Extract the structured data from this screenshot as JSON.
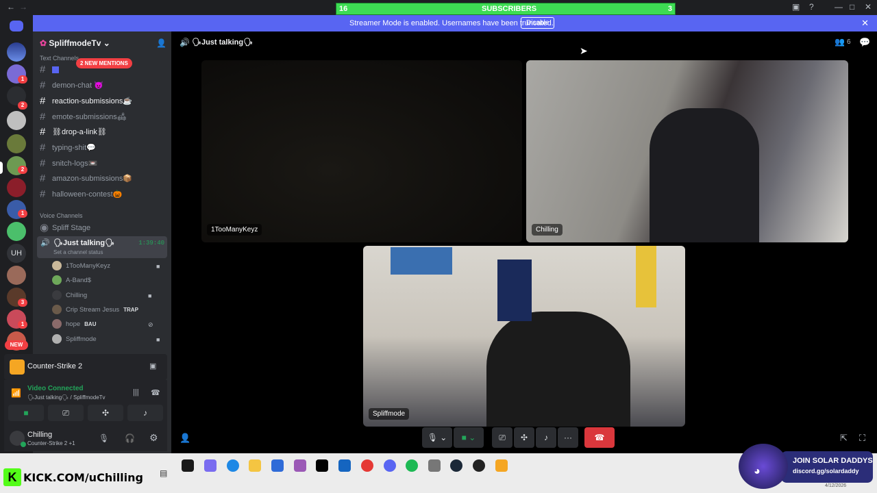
{
  "subscribers": {
    "left_count": "16",
    "label": "SUBSCRIBERS",
    "right_count": "3"
  },
  "banner": {
    "message": "Streamer Mode is enabled. Usernames have been truncated.",
    "disable": "Disable"
  },
  "server": {
    "name": "SpliffmodeTv"
  },
  "mentions": "2 NEW MENTIONS",
  "rail": {
    "uh": "UH",
    "new": "NEW",
    "badges": [
      "1",
      "2",
      "2",
      "1",
      "1",
      "3",
      "1"
    ]
  },
  "categories": {
    "text": "Text Channels",
    "voice": "Voice Channels"
  },
  "text_channels": [
    "demon-chat 😈",
    "reaction-submissions☕",
    "emote-submissions🛋",
    "⛓drop-a-link⛓",
    "typing-shit💬",
    "snitch-logs📼",
    "amazon-submissions📦",
    "halloween-contest🎃"
  ],
  "voice_channels": {
    "stage": "Spliff Stage",
    "active": "🗣Just talking🗣",
    "timer": "1:39:40",
    "status": "Set a channel status",
    "users": [
      "1TooManyKeyz",
      "A-Band$",
      "Chilling",
      "Crip Stream Jesus",
      "hope",
      "Spliffmode"
    ],
    "user_tags": {
      "crip": "TRAP",
      "hope": "BAU"
    }
  },
  "game": {
    "name": "Counter-Strike 2"
  },
  "voice_status": {
    "title": "Video Connected",
    "sub": "🗣Just talking🗣 / SpliffmodeTv"
  },
  "user_panel": {
    "name": "Chilling",
    "activity": "Counter-Strike 2 +1"
  },
  "header": {
    "channel": "🗣Just talking🗣",
    "member_count": "6"
  },
  "tiles": {
    "a": "1TooManyKeyz",
    "b": "Chilling",
    "c": "Spliffmode"
  },
  "overlay": {
    "kick": "KICK.COM/uChilling",
    "join": "JOIN SOLAR DADDYS",
    "discord": "discord.gg/solardaddy"
  },
  "clock": {
    "date": "4/12/2026"
  },
  "colors": {
    "blurple": "#5865f2",
    "green": "#3ddc53",
    "red": "#da373c",
    "online": "#23a55a"
  }
}
